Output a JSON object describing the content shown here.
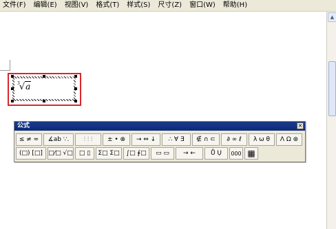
{
  "menubar": {
    "items": [
      {
        "label": "文件(F)"
      },
      {
        "label": "编辑(E)"
      },
      {
        "label": "视图(V)"
      },
      {
        "label": "格式(T)"
      },
      {
        "label": "样式(S)"
      },
      {
        "label": "尺寸(Z)"
      },
      {
        "label": "窗口(W)"
      },
      {
        "label": "帮助(H)"
      }
    ]
  },
  "equation": {
    "index": "3",
    "radical": "√",
    "radicand": "a"
  },
  "toolbar": {
    "title": "公式",
    "close_glyph": "×",
    "row1": [
      {
        "label": "≤ ≠ ≈"
      },
      {
        "label": "∡ab ∵."
      },
      {
        "label": "⫶ ⫶ ⫶"
      },
      {
        "label": "± • ⊗"
      },
      {
        "label": "→ ⇔ ↓"
      },
      {
        "label": "∴ ∀ ∃"
      },
      {
        "label": "∉ ∩ ⊂"
      },
      {
        "label": "∂ ∞ ℓ"
      },
      {
        "label": "λ ω θ"
      },
      {
        "label": "Λ Ω ⊛"
      }
    ],
    "row2": [
      {
        "label": "(□) [□]"
      },
      {
        "label": "□⁄□ √□"
      },
      {
        "label": "□ ▯"
      },
      {
        "label": "Σ□ Σ□"
      },
      {
        "label": "∫□ ∮□"
      },
      {
        "label": "▭ ▭"
      },
      {
        "label": "→ ←"
      },
      {
        "label": "Ů Ụ"
      },
      {
        "label": "000"
      },
      {
        "label": "▦"
      }
    ]
  }
}
